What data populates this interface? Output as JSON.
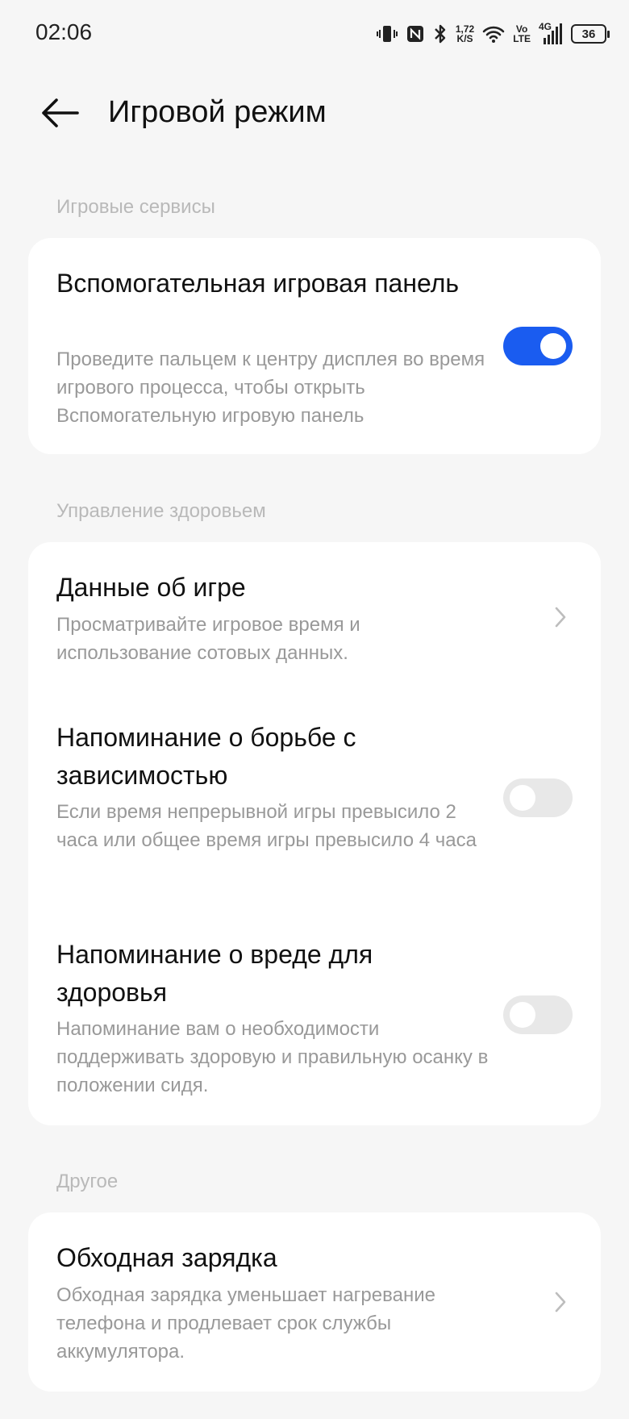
{
  "status_bar": {
    "time": "02:06",
    "speed_value": "1,72",
    "speed_unit": "K/S",
    "volte_top": "Vo",
    "volte_bottom": "LTE",
    "network": "4G",
    "battery": "36"
  },
  "header": {
    "title": "Игровой режим"
  },
  "sections": [
    {
      "title": "Игровые сервисы",
      "items": [
        {
          "title": "Вспомогательная игровая панель",
          "description": "Проведите пальцем к центру дисплея во время игрового процесса, чтобы открыть Вспомогательную игровую панель",
          "control": "toggle",
          "enabled": true
        }
      ]
    },
    {
      "title": "Управление здоровьем",
      "items": [
        {
          "title": "Данные об игре",
          "description": "Просматривайте игровое время и использование сотовых данных.",
          "control": "chevron"
        },
        {
          "title": "Напоминание о борьбе с зависимостью",
          "description": "Если время непрерывной игры превысило 2 часа или общее время игры превысило 4 часа",
          "control": "toggle",
          "enabled": false
        },
        {
          "title": "Напоминание о вреде для здоровья",
          "description": "Напоминание вам о необходимости поддерживать здоровую и правильную осанку в положении сидя.",
          "control": "toggle",
          "enabled": false
        }
      ]
    },
    {
      "title": "Другое",
      "items": [
        {
          "title": "Обходная зарядка",
          "description": "Обходная зарядка уменьшает нагревание телефона и продлевает срок службы аккумулятора.",
          "control": "chevron"
        }
      ]
    }
  ],
  "colors": {
    "accent": "#1a5cf0",
    "background": "#f6f6f6",
    "card": "#ffffff",
    "section_title": "#b9b9b9",
    "description": "#999999"
  }
}
